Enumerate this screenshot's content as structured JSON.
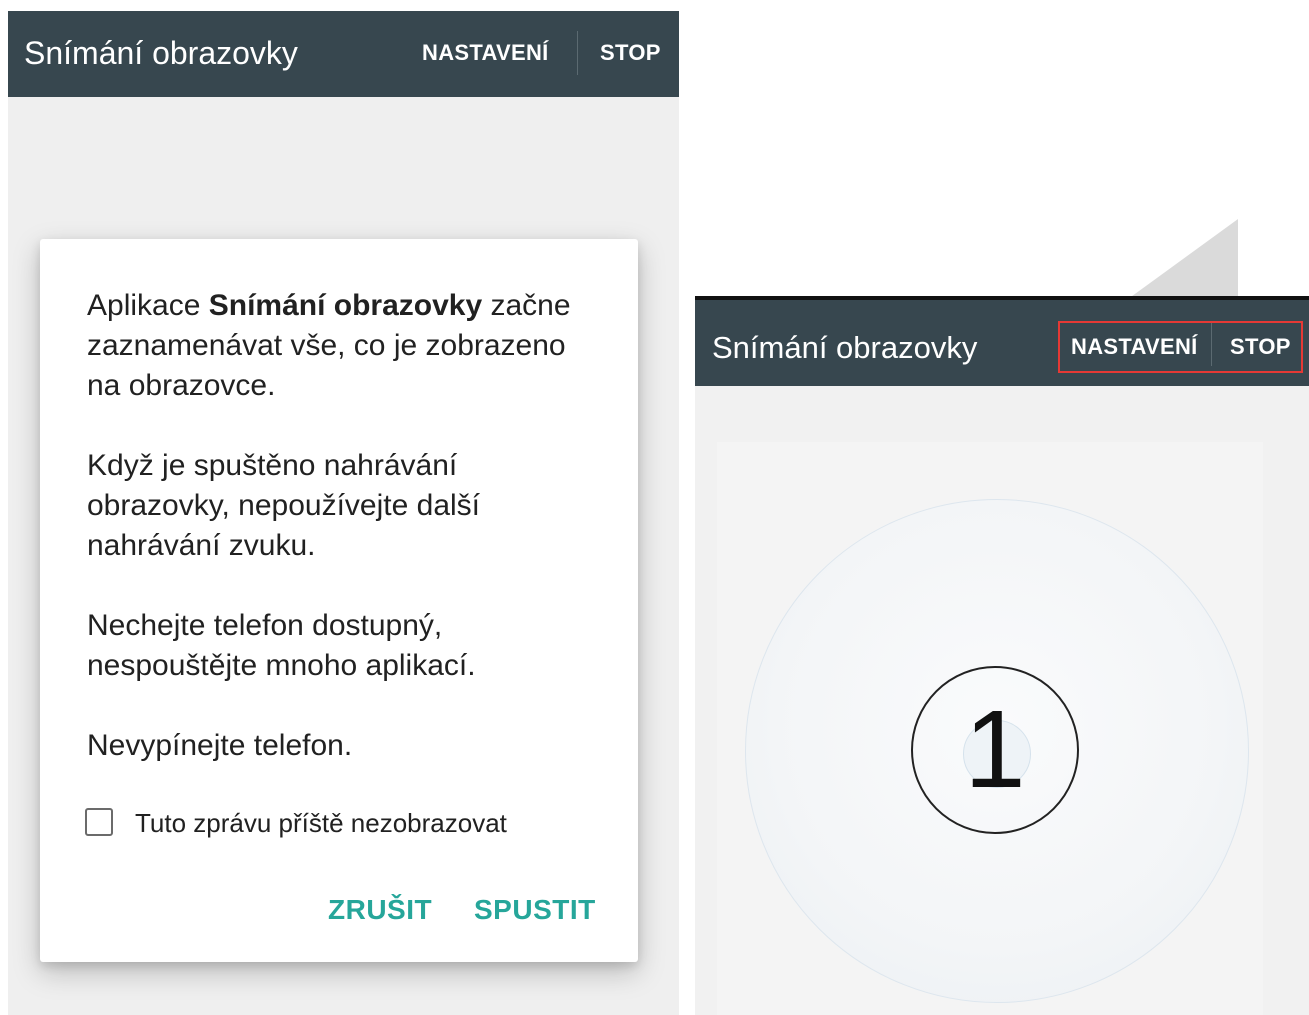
{
  "left": {
    "app_title": "Snímání obrazovky",
    "action_settings": "NASTAVENÍ",
    "action_stop": "STOP",
    "dialog": {
      "p1_prefix": "Aplikace ",
      "p1_app_name": "Snímání obrazovky",
      "p1_suffix": " začne zaznamenávat vše, co je zobrazeno na obrazovce.",
      "p2": "Když je spuštěno nahrávání obrazovky, nepoužívejte další nahrávání zvuku.",
      "p3": "Nechejte telefon dostupný, nespouštějte mnoho aplikací.",
      "p4": "Nevypínejte telefon.",
      "checkbox_label": "Tuto zprávu příště nezobrazovat",
      "checkbox_checked": false,
      "cancel_label": "ZRUŠIT",
      "start_label": "SPUSTIT"
    }
  },
  "right": {
    "app_title": "Snímání obrazovky",
    "action_settings": "NASTAVENÍ",
    "action_stop": "STOP",
    "countdown": "1"
  },
  "colors": {
    "appbar": "#37474f",
    "accent": "#26a69a",
    "highlight": "#e53935"
  }
}
